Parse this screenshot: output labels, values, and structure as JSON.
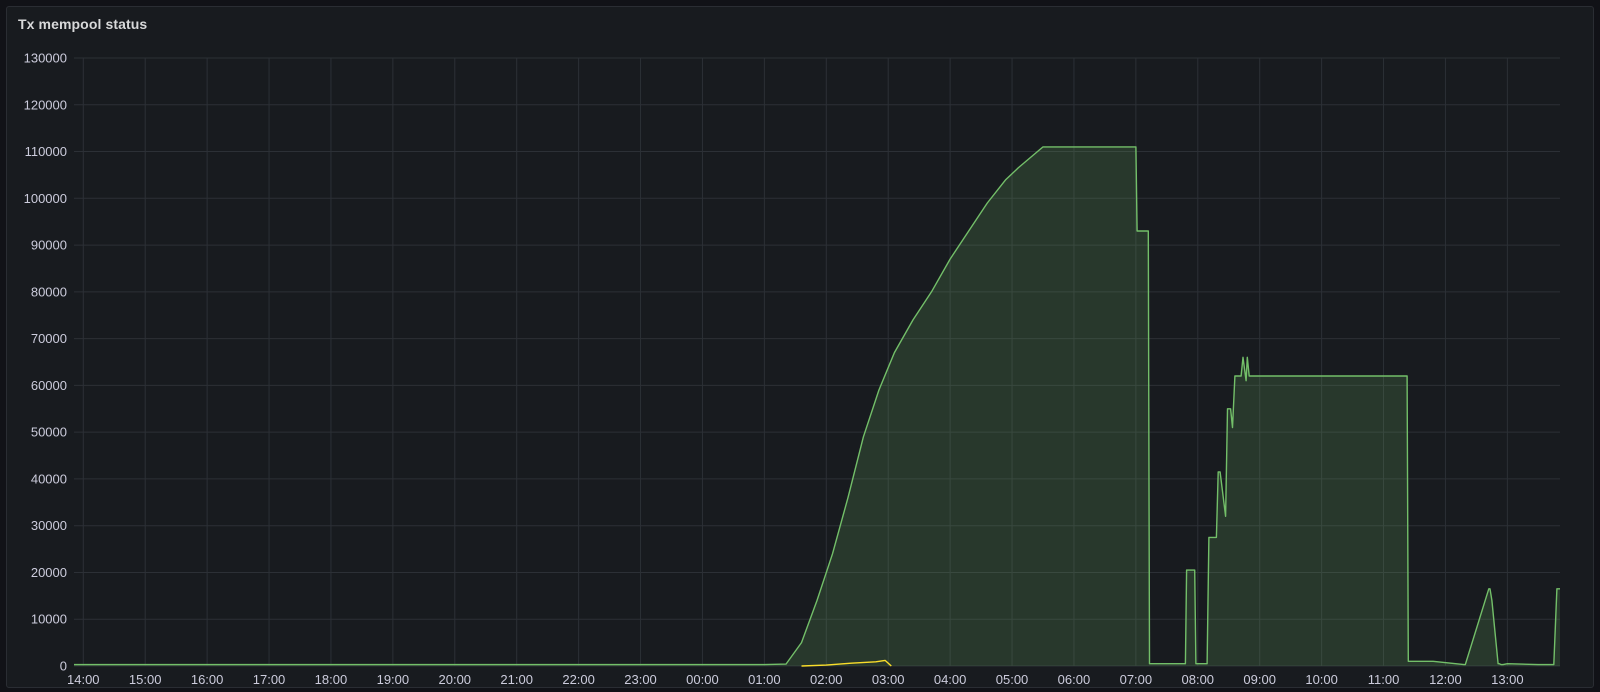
{
  "panel": {
    "title": "Tx mempool status"
  },
  "colors": {
    "background": "#181b1f",
    "grid": "#2c3036",
    "series_green": "#73bf69",
    "series_green_fill": "rgba(115,191,105,0.18)",
    "series_yellow": "#fade2a"
  },
  "chart_data": {
    "type": "area",
    "title": "Tx mempool status",
    "xlabel": "",
    "ylabel": "",
    "x_unit": "hours since 14:00 of the first day",
    "xlim": [
      -0.15,
      23.85
    ],
    "ylim": [
      0,
      130000
    ],
    "grid": true,
    "legend": "none",
    "x_ticks": [
      {
        "x": 0,
        "label": "14:00"
      },
      {
        "x": 1,
        "label": "15:00"
      },
      {
        "x": 2,
        "label": "16:00"
      },
      {
        "x": 3,
        "label": "17:00"
      },
      {
        "x": 4,
        "label": "18:00"
      },
      {
        "x": 5,
        "label": "19:00"
      },
      {
        "x": 6,
        "label": "20:00"
      },
      {
        "x": 7,
        "label": "21:00"
      },
      {
        "x": 8,
        "label": "22:00"
      },
      {
        "x": 9,
        "label": "23:00"
      },
      {
        "x": 10,
        "label": "00:00"
      },
      {
        "x": 11,
        "label": "01:00"
      },
      {
        "x": 12,
        "label": "02:00"
      },
      {
        "x": 13,
        "label": "03:00"
      },
      {
        "x": 14,
        "label": "04:00"
      },
      {
        "x": 15,
        "label": "05:00"
      },
      {
        "x": 16,
        "label": "06:00"
      },
      {
        "x": 17,
        "label": "07:00"
      },
      {
        "x": 18,
        "label": "08:00"
      },
      {
        "x": 19,
        "label": "09:00"
      },
      {
        "x": 20,
        "label": "10:00"
      },
      {
        "x": 21,
        "label": "11:00"
      },
      {
        "x": 22,
        "label": "12:00"
      },
      {
        "x": 23,
        "label": "13:00"
      }
    ],
    "y_ticks": [
      {
        "y": 0,
        "label": "0"
      },
      {
        "y": 10000,
        "label": "10000"
      },
      {
        "y": 20000,
        "label": "20000"
      },
      {
        "y": 30000,
        "label": "30000"
      },
      {
        "y": 40000,
        "label": "40000"
      },
      {
        "y": 50000,
        "label": "50000"
      },
      {
        "y": 60000,
        "label": "60000"
      },
      {
        "y": 70000,
        "label": "70000"
      },
      {
        "y": 80000,
        "label": "80000"
      },
      {
        "y": 90000,
        "label": "90000"
      },
      {
        "y": 100000,
        "label": "100000"
      },
      {
        "y": 110000,
        "label": "110000"
      },
      {
        "y": 120000,
        "label": "120000"
      },
      {
        "y": 130000,
        "label": "130000"
      }
    ],
    "series": [
      {
        "color": "#73bf69",
        "fill": true,
        "x": [
          -0.15,
          1,
          2,
          3,
          4,
          5,
          6,
          7,
          8,
          9,
          10,
          11,
          11.35,
          11.6,
          11.85,
          12.1,
          12.35,
          12.6,
          12.85,
          13.1,
          13.4,
          13.7,
          14,
          14.3,
          14.6,
          14.9,
          15.1,
          15.5,
          16,
          16.5,
          17.0,
          17.02,
          17.2,
          17.22,
          17.25,
          17.8,
          17.82,
          17.95,
          17.97,
          18.15,
          18.18,
          18.3,
          18.33,
          18.36,
          18.45,
          18.48,
          18.5,
          18.53,
          18.56,
          18.6,
          18.63,
          18.7,
          18.73,
          18.78,
          18.8,
          18.83,
          18.9,
          18.92,
          19.0,
          19.02,
          19.05,
          19.08,
          19.1,
          19.13,
          19.15,
          19.18,
          19.2,
          19.22,
          19.5,
          20.5,
          21.38,
          21.4,
          21.8,
          22.3,
          22.32,
          22.7,
          22.72,
          22.75,
          22.85,
          22.87,
          22.9,
          22.93,
          23.0,
          23.5,
          23.75,
          23.8,
          23.85
        ],
        "y": [
          300,
          300,
          300,
          300,
          300,
          300,
          300,
          300,
          300,
          300,
          300,
          300,
          400,
          5000,
          14000,
          24000,
          36000,
          49000,
          59000,
          67000,
          74000,
          80000,
          87000,
          93000,
          99000,
          104000,
          106500,
          111000,
          111000,
          111000,
          111000,
          93000,
          93000,
          500,
          500,
          500,
          20500,
          20500,
          500,
          500,
          27500,
          27500,
          41500,
          41500,
          32000,
          55000,
          55000,
          55000,
          51000,
          62000,
          62000,
          62000,
          66000,
          61000,
          66000,
          62000,
          62000,
          62000,
          62000,
          62000,
          62000,
          62000,
          62000,
          62000,
          62000,
          62000,
          62000,
          62000,
          62000,
          62000,
          62000,
          1000,
          1000,
          300,
          300,
          16500,
          16500,
          14000,
          500,
          500,
          300,
          300,
          500,
          300,
          300,
          16500,
          16500
        ]
      },
      {
        "color": "#fade2a",
        "fill": false,
        "x": [
          11.6,
          12.0,
          12.4,
          12.8,
          12.95,
          13.05
        ],
        "y": [
          0,
          200,
          600,
          900,
          1200,
          0
        ]
      }
    ]
  }
}
